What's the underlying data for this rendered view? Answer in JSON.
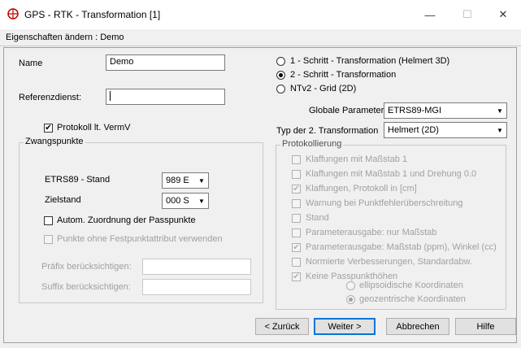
{
  "window": {
    "title": "GPS - RTK - Transformation [1]",
    "minimize": "—",
    "maximize": "☐",
    "close": "✕"
  },
  "header": {
    "text": "Eigenschaften ändern : Demo"
  },
  "left": {
    "name_label": "Name",
    "name_value": "Demo",
    "referenzdienst_label": "Referenzdienst:",
    "referenzdienst_value": "",
    "protokoll_label": "Protokoll lt. VermV",
    "zwangspunkte": {
      "legend": "Zwangspunkte",
      "etrs_label": "ETRS89 - Stand",
      "etrs_value": "989  E",
      "zielstand_label": "Zielstand",
      "zielstand_value": "000  S",
      "autom_label": "Autom. Zuordnung der Passpunkte",
      "festpunkt_label": "Punkte ohne Festpunktattribut verwenden",
      "praefix_label": "Präfix berücksichtigen:",
      "suffix_label": "Suffix berücksichtigen:"
    }
  },
  "right": {
    "radio1": "1 - Schritt - Transformation (Helmert 3D)",
    "radio2": "2 - Schritt - Transformation",
    "radio3": "NTv2 - Grid (2D)",
    "globale_label": "Globale Parameter",
    "globale_value": "ETRS89-MGI",
    "typ_label": "Typ der 2. Transformation",
    "typ_value": "Helmert (2D)",
    "protokollierung": {
      "legend": "Protokollierung",
      "items": [
        "Klaffungen mit Maßstab 1",
        "Klaffungen mit Maßstab 1 und Drehung 0.0",
        "Klaffungen, Protokoll in [cm]",
        "Warnung bei Punktfehlerüberschreitung",
        "Stand",
        "Parameterausgabe: nur Maßstab",
        "Parameterausgabe: Maßstab (ppm), Winkel (cc)",
        "Normierte Verbesserungen, Standardabw.",
        "Keine Passpunkthöhen"
      ],
      "radio_ellipsoid": "ellipsoidische Koordinaten",
      "radio_geozentrisch": "geozentrische Koordinaten"
    }
  },
  "buttons": {
    "back": "< Zurück",
    "next": "Weiter >",
    "cancel": "Abbrechen",
    "help": "Hilfe"
  },
  "colors": {
    "accent": "#0078d7",
    "dialog_bg": "#f0f0f0",
    "disabled_text": "#a0a0a0"
  }
}
